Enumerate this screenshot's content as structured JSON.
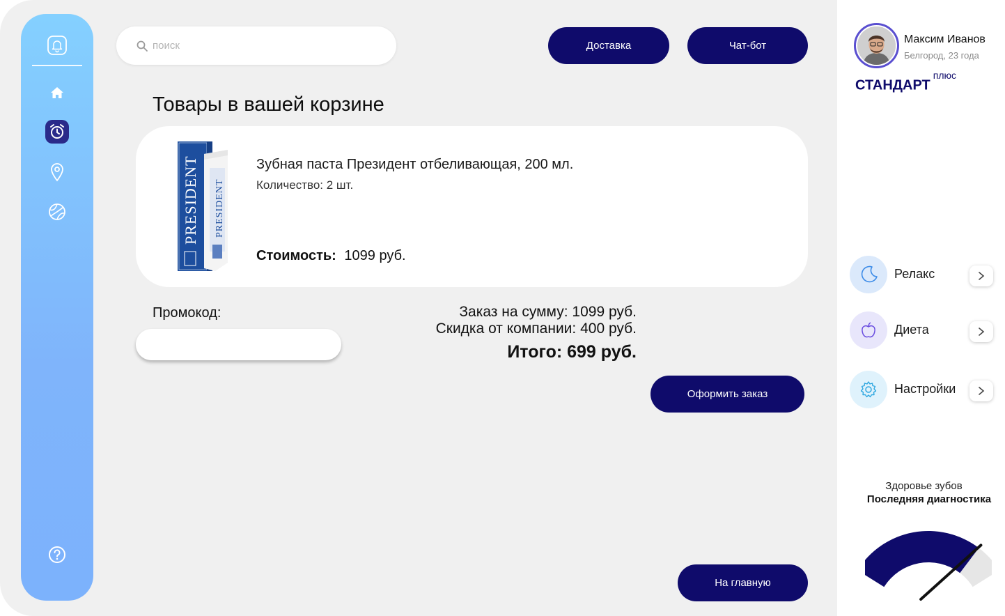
{
  "search": {
    "placeholder": "поиск"
  },
  "header": {
    "delivery_label": "Доставка",
    "chatbot_label": "Чат-бот"
  },
  "page_title": "Товары в вашей корзине",
  "cart": {
    "items": [
      {
        "name": "Зубная паста Президент отбеливающая, 200 мл.",
        "quantity_text": "Количество: 2 шт.",
        "cost_label": "Стоимость:",
        "cost_value": "1099 руб."
      }
    ]
  },
  "promo": {
    "label": "Промокод:",
    "value": ""
  },
  "summary": {
    "order_sum": "Заказ на сумму: 1099 руб.",
    "discount": "Скидка от компании: 400 руб.",
    "total": "Итого: 699 руб.",
    "checkout_label": "Оформить заказ"
  },
  "footer": {
    "home_label": "На главную"
  },
  "user": {
    "name": "Максим Иванов",
    "meta": "Белгород, 23 года",
    "plan": "СТАНДАРТ",
    "plan_suffix": "плюс"
  },
  "menu": [
    {
      "label": "Релакс",
      "icon": "moon-icon"
    },
    {
      "label": "Диета",
      "icon": "apple-icon"
    },
    {
      "label": "Настройки",
      "icon": "gear-icon"
    }
  ],
  "teeth_health": {
    "title": "Здоровье зубов",
    "subtitle": "Последняя диагностика",
    "level": 0.82
  },
  "colors": {
    "accent": "#0f0b6b",
    "sidebar_top": "#84d0ff",
    "sidebar_bottom": "#7cb2fc",
    "background": "#f0f0f0"
  }
}
